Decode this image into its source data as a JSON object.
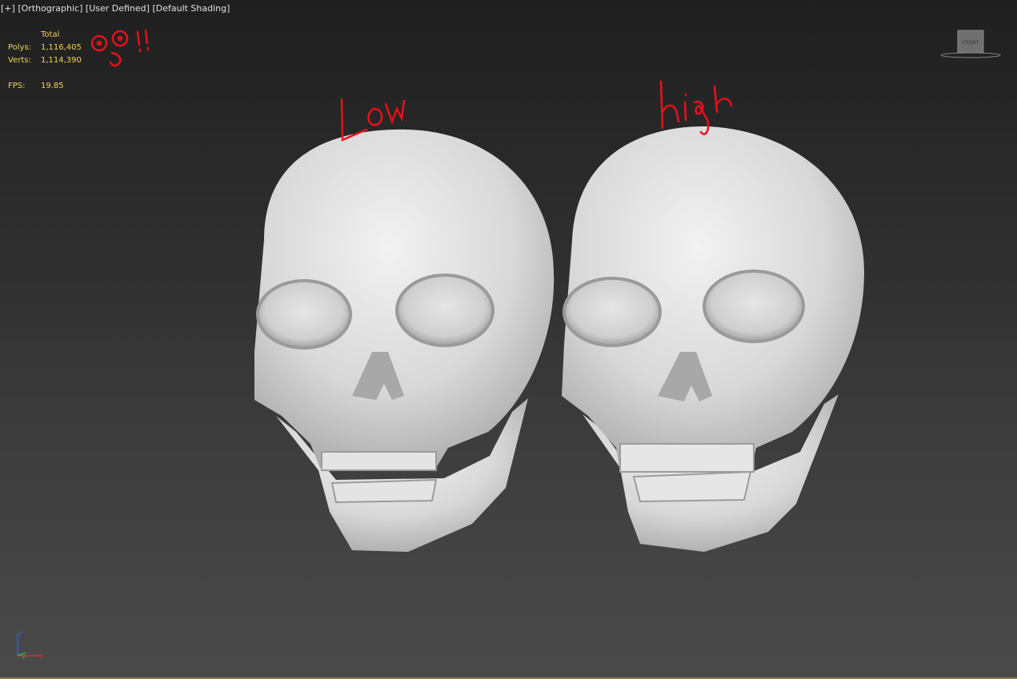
{
  "viewport": {
    "label_plus": "[+]",
    "label_view": "[Orthographic]",
    "label_camera": "[User Defined]",
    "label_shading": "[Default Shading]"
  },
  "stats": {
    "header": "Total",
    "polys_label": "Polys:",
    "polys_value": "1,116,405",
    "verts_label": "Verts:",
    "verts_value": "1,114,390",
    "fps_label": "FPS:",
    "fps_value": "19.85"
  },
  "viewcube": {
    "face_label": "FRONT"
  },
  "annotations": {
    "exclamation": "O_O!!",
    "low": "Low",
    "high": "High",
    "color": "#e8101a"
  },
  "axis": {
    "x": "x",
    "y": "y",
    "z": "z"
  },
  "colors": {
    "stats_text": "#f2d25a",
    "label_text": "#e0e0e0",
    "bone": "#dcdcdc"
  }
}
